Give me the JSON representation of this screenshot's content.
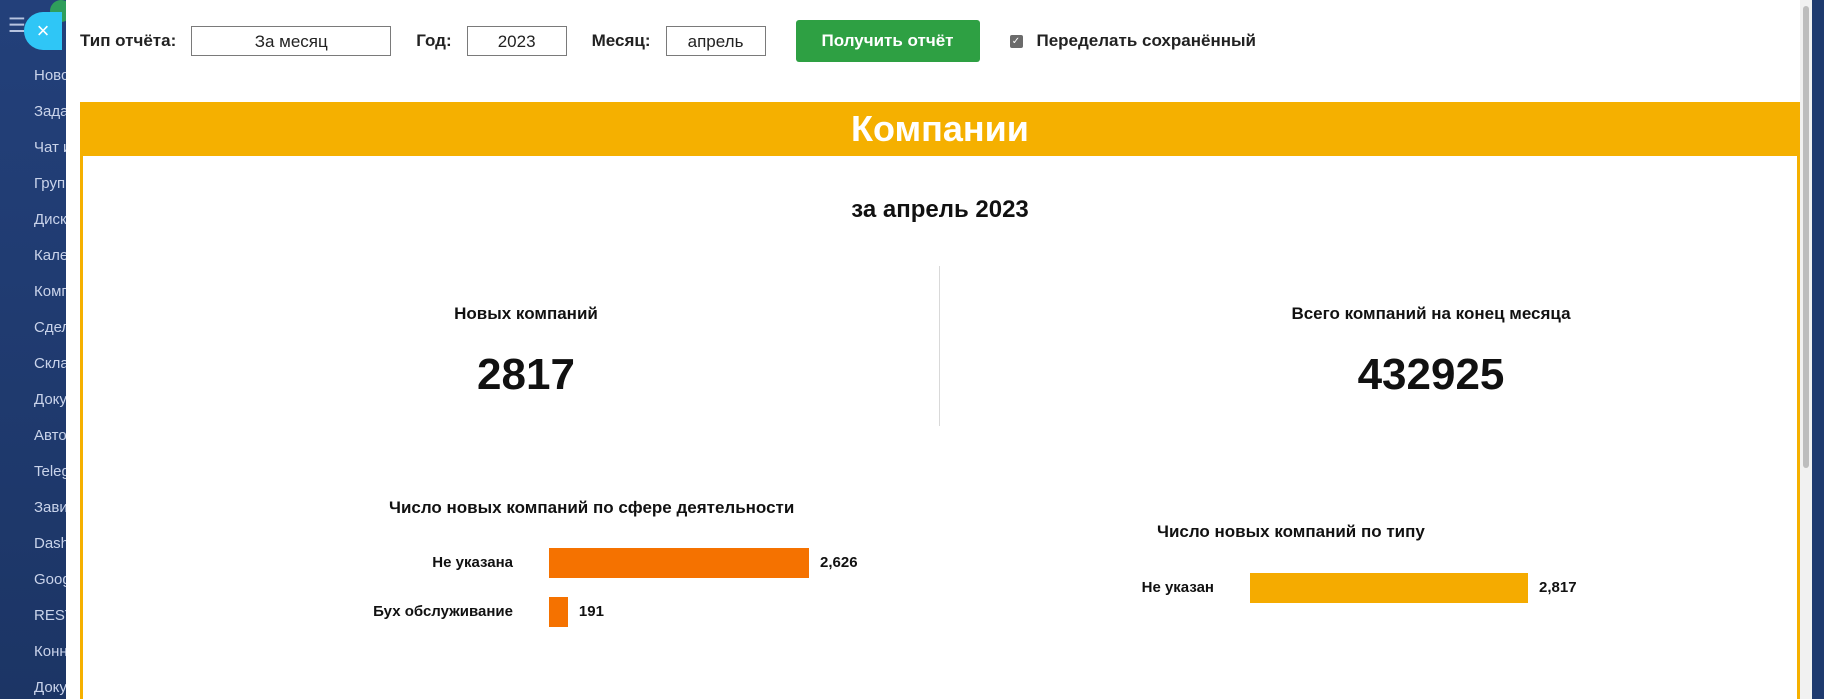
{
  "sidebar": {
    "items": [
      "Ново",
      "Зада",
      "Чат и",
      "Груп",
      "Диск",
      "Кале",
      "Комп",
      "Сдел",
      "Скла",
      "Доку",
      "Авто",
      "Teleg",
      "Зави",
      "Dash",
      "Goog",
      "REST",
      "Конн",
      "Доку"
    ]
  },
  "toolbar": {
    "report_type_label": "Тип отчёта:",
    "report_type_value": "За месяц",
    "year_label": "Год:",
    "year_value": "2023",
    "month_label": "Месяц:",
    "month_value": "апрель",
    "submit_label": "Получить отчёт",
    "redo_label": "Переделать сохранённый",
    "redo_checked": true
  },
  "report": {
    "title": "Компании",
    "period": "за апрель 2023",
    "kpi_new_label": "Новых компаний",
    "kpi_new_value": "2817",
    "kpi_total_label": "Всего компаний на конец месяца",
    "kpi_total_value": "432925"
  },
  "colors": {
    "accent": "#f5b000",
    "button": "#2ea043",
    "bar_orange": "#f57200",
    "bar_yellow": "#f5ab00"
  },
  "chart_data": [
    {
      "type": "bar",
      "orientation": "horizontal",
      "title": "Число новых компаний по сфере деятельности",
      "categories": [
        "Не указана",
        "Бух обслуживание"
      ],
      "values": [
        2626,
        191
      ],
      "value_labels": [
        "2,626",
        "191"
      ],
      "color": "#f57200"
    },
    {
      "type": "bar",
      "orientation": "horizontal",
      "title": "Число новых компаний по типу",
      "categories": [
        "Не указан"
      ],
      "values": [
        2817
      ],
      "value_labels": [
        "2,817"
      ],
      "color": "#f5ab00"
    }
  ]
}
